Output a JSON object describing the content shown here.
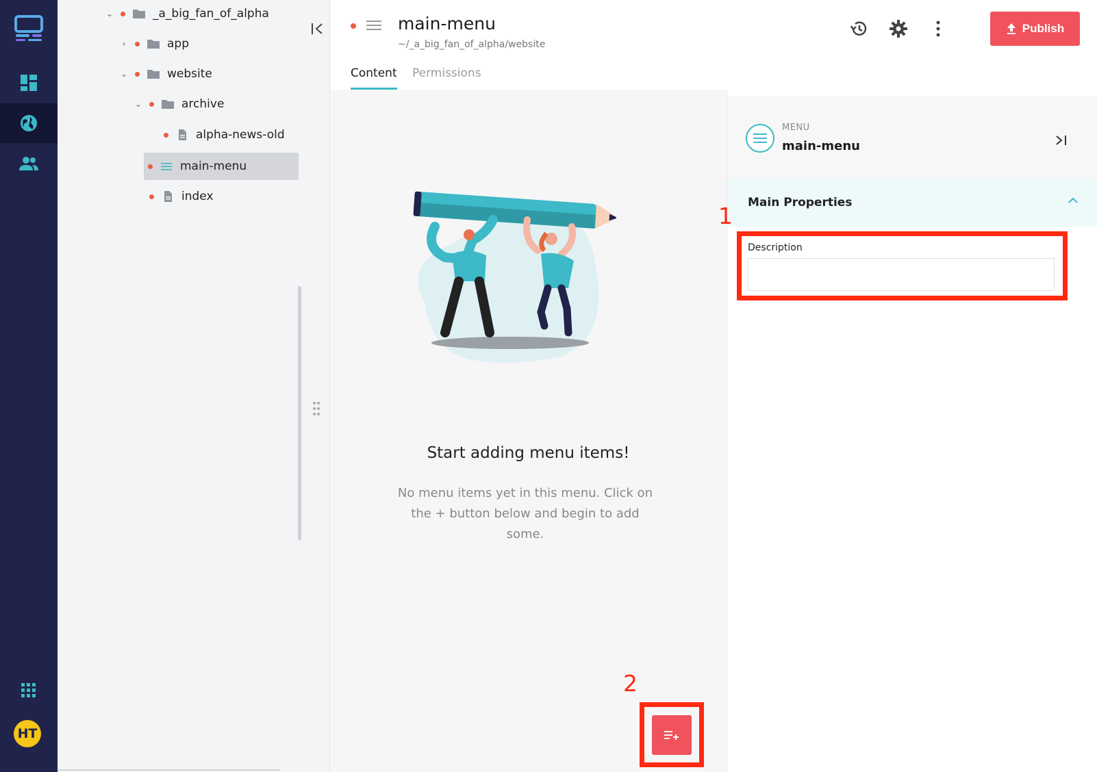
{
  "tree": {
    "items": [
      {
        "label": "_a_big_fan_of_alpha",
        "type": "folder",
        "expanded": true
      },
      {
        "label": "app",
        "type": "folder",
        "expanded": false
      },
      {
        "label": "website",
        "type": "folder",
        "expanded": true
      },
      {
        "label": "archive",
        "type": "folder",
        "expanded": true
      },
      {
        "label": "alpha-news-old",
        "type": "page"
      },
      {
        "label": "main-menu",
        "type": "menu",
        "selected": true
      },
      {
        "label": "index",
        "type": "page"
      }
    ]
  },
  "header": {
    "title": "main-menu",
    "path": "~/_a_big_fan_of_alpha/website",
    "tabs": [
      "Content",
      "Permissions"
    ],
    "publish_label": "Publish"
  },
  "content": {
    "empty_title": "Start adding menu items!",
    "empty_desc": "No menu items yet in this menu. Click on the + button below and begin to add some."
  },
  "props": {
    "type_label": "MENU",
    "name": "main-menu",
    "section_title": "Main Properties",
    "description_label": "Description",
    "description_value": ""
  },
  "user": {
    "initials": "HT"
  },
  "annotations": {
    "one": "1",
    "two": "2"
  },
  "colors": {
    "rail": "#20234a",
    "accent": "#3db9c7",
    "publish": "#f0535c",
    "annotation": "#ff2a12",
    "status_dot": "#f05b41"
  }
}
